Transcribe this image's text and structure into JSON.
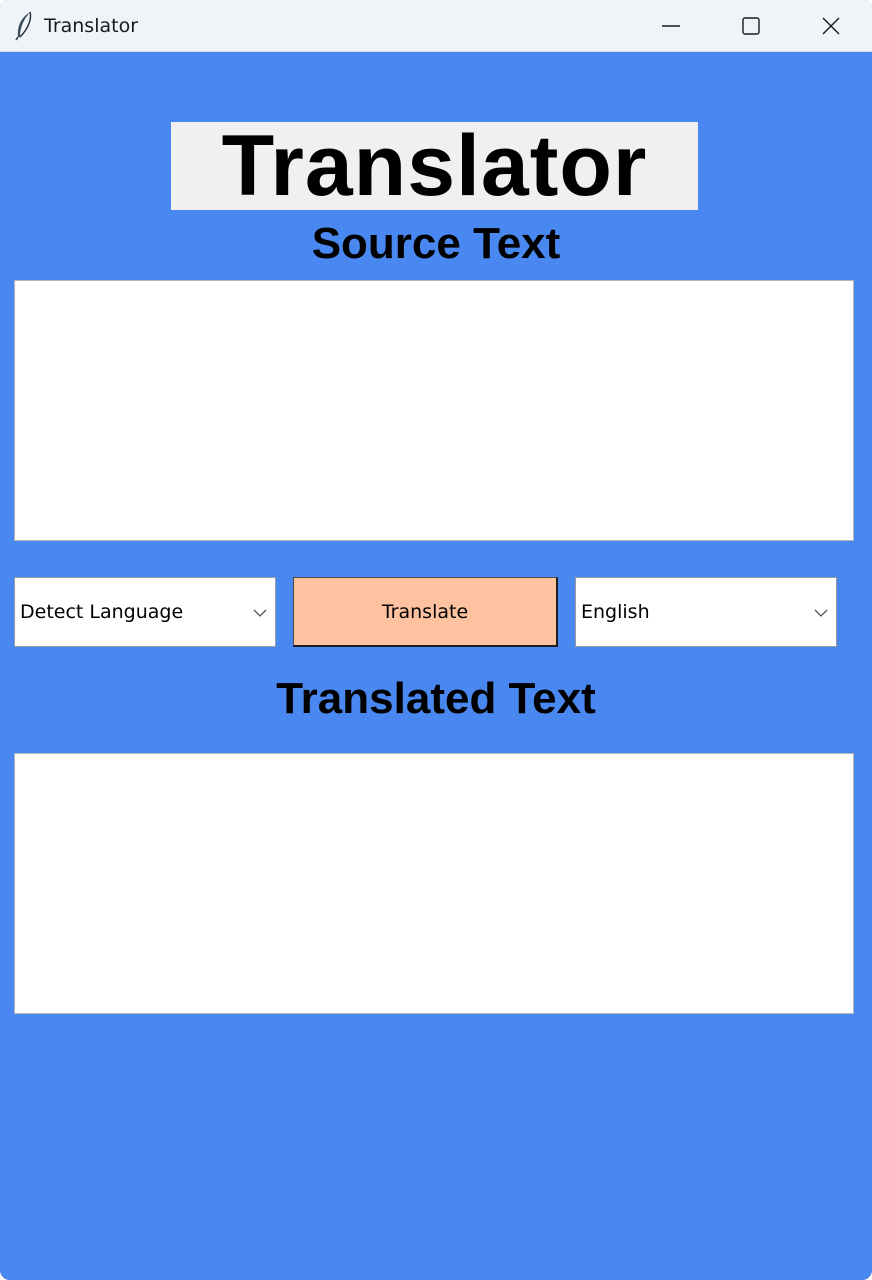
{
  "window": {
    "title": "Translator",
    "icon": "feather-icon",
    "controls": [
      "minimize-icon",
      "maximize-icon",
      "close-icon"
    ]
  },
  "app": {
    "heading": "Translator",
    "source_label": "Source Text",
    "translated_label": "Translated Text",
    "source_text": "",
    "translated_text": "",
    "source_language": "Detect Language",
    "translate_button": "Translate",
    "target_language": "English"
  },
  "colors": {
    "background": "#4a88f1",
    "title_box": "#f0f0f0",
    "translate_button": "#ffc2a0",
    "titlebar": "#eef4f8"
  }
}
